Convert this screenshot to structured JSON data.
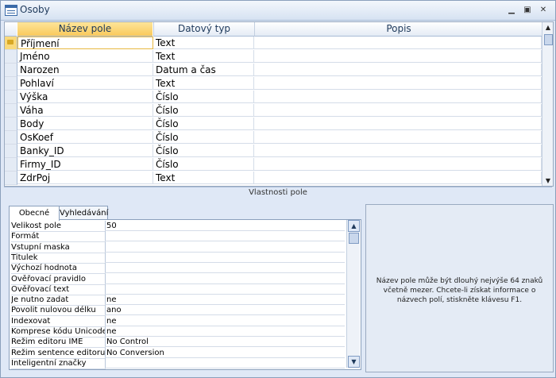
{
  "window": {
    "title": "Osoby"
  },
  "grid": {
    "headers": {
      "name": "Název pole",
      "type": "Datový typ",
      "desc": "Popis"
    },
    "rows": [
      {
        "name": "Příjmení",
        "type": "Text"
      },
      {
        "name": "Jméno",
        "type": "Text"
      },
      {
        "name": "Narozen",
        "type": "Datum a čas"
      },
      {
        "name": "Pohlaví",
        "type": "Text"
      },
      {
        "name": "Výška",
        "type": "Číslo"
      },
      {
        "name": "Váha",
        "type": "Číslo"
      },
      {
        "name": "Body",
        "type": "Číslo"
      },
      {
        "name": "OsKoef",
        "type": "Číslo"
      },
      {
        "name": "Banky_ID",
        "type": "Číslo"
      },
      {
        "name": "Firmy_ID",
        "type": "Číslo"
      },
      {
        "name": "ZdrPoj",
        "type": "Text"
      }
    ]
  },
  "field_props_label": "Vlastnosti pole",
  "tabs": {
    "general": "Obecné",
    "lookup": "Vyhledávání"
  },
  "properties": [
    {
      "label": "Velikost pole",
      "value": "50"
    },
    {
      "label": "Formát",
      "value": ""
    },
    {
      "label": "Vstupní maska",
      "value": ""
    },
    {
      "label": "Titulek",
      "value": ""
    },
    {
      "label": "Výchozí hodnota",
      "value": ""
    },
    {
      "label": "Ověřovací pravidlo",
      "value": ""
    },
    {
      "label": "Ověřovací text",
      "value": ""
    },
    {
      "label": "Je nutno zadat",
      "value": "ne"
    },
    {
      "label": "Povolit nulovou délku",
      "value": "ano"
    },
    {
      "label": "Indexovat",
      "value": "ne"
    },
    {
      "label": "Komprese kódu Unicode",
      "value": "ne"
    },
    {
      "label": "Režim editoru IME",
      "value": "No Control"
    },
    {
      "label": "Režim sentence editoru IME",
      "value": "No Conversion"
    },
    {
      "label": "Inteligentní značky",
      "value": ""
    }
  ],
  "help_text": "Název pole může být dlouhý nejvýše 64 znaků včetně mezer. Chcete-li získat informace o názvech polí, stiskněte klávesu F1."
}
